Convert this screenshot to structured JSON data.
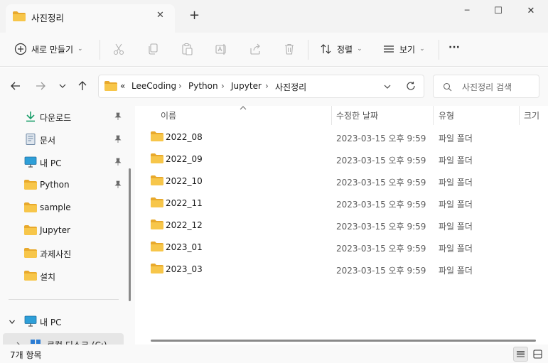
{
  "window": {
    "tab_title": "사진정리",
    "tab_close": "✕",
    "new_tab": "+",
    "minimize": "─",
    "maximize": "☐",
    "close": "✕"
  },
  "toolbar": {
    "new_label": "새로 만들기",
    "sort_label": "정렬",
    "view_label": "보기",
    "more_label": "···"
  },
  "address": {
    "overflow": "«",
    "breadcrumb": [
      "LeeCoding",
      "Python",
      "Jupyter",
      "사진정리"
    ],
    "search_placeholder": "사진정리 검색"
  },
  "sidebar": {
    "items": [
      {
        "label": "다운로드",
        "icon": "download-icon",
        "pinned": true
      },
      {
        "label": "문서",
        "icon": "document-icon",
        "pinned": true
      },
      {
        "label": "내 PC",
        "icon": "computer-icon",
        "pinned": true
      },
      {
        "label": "Python",
        "icon": "folder-icon",
        "pinned": true
      },
      {
        "label": "sample",
        "icon": "folder-icon",
        "pinned": false
      },
      {
        "label": "Jupyter",
        "icon": "folder-icon",
        "pinned": false
      },
      {
        "label": "과제사진",
        "icon": "folder-icon",
        "pinned": false
      },
      {
        "label": "설치",
        "icon": "folder-icon",
        "pinned": false
      }
    ],
    "this_pc": "내 PC",
    "local_disk": "로컬 디스크 (C:)"
  },
  "columns": {
    "name": "이름",
    "date": "수정한 날짜",
    "type": "유형",
    "size": "크기"
  },
  "files": [
    {
      "name": "2022_08",
      "date": "2023-03-15 오후 9:59",
      "type": "파일 폴더"
    },
    {
      "name": "2022_09",
      "date": "2023-03-15 오후 9:59",
      "type": "파일 폴더"
    },
    {
      "name": "2022_10",
      "date": "2023-03-15 오후 9:59",
      "type": "파일 폴더"
    },
    {
      "name": "2022_11",
      "date": "2023-03-15 오후 9:59",
      "type": "파일 폴더"
    },
    {
      "name": "2022_12",
      "date": "2023-03-15 오후 9:59",
      "type": "파일 폴더"
    },
    {
      "name": "2023_01",
      "date": "2023-03-15 오후 9:59",
      "type": "파일 폴더"
    },
    {
      "name": "2023_03",
      "date": "2023-03-15 오후 9:59",
      "type": "파일 폴더"
    }
  ],
  "status": {
    "count": "7개 항목"
  },
  "colors": {
    "folder": "#f7c64a",
    "folder_dark": "#e8a92c",
    "accent": "#0067c0"
  }
}
